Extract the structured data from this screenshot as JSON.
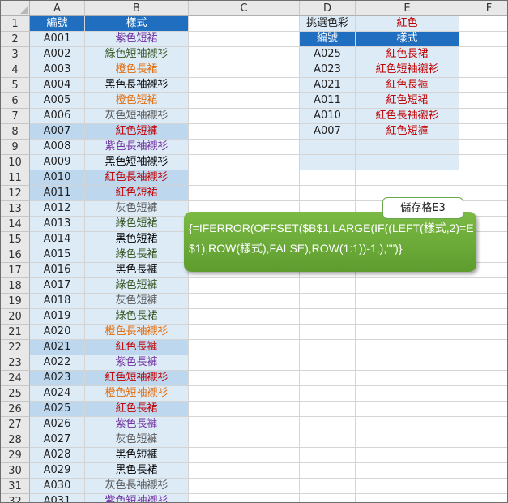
{
  "columns": [
    "A",
    "B",
    "C",
    "D",
    "E",
    "F"
  ],
  "left_table": {
    "header": {
      "code": "編號",
      "style": "樣式"
    },
    "rows": [
      {
        "code": "A001",
        "style": "紫色短裙",
        "color": "#7030a0"
      },
      {
        "code": "A002",
        "style": "綠色短袖襯衫",
        "color": "#375623"
      },
      {
        "code": "A003",
        "style": "橙色長裙",
        "color": "#e46c0a"
      },
      {
        "code": "A004",
        "style": "黑色長袖襯衫",
        "color": "#000000"
      },
      {
        "code": "A005",
        "style": "橙色短裙",
        "color": "#e46c0a"
      },
      {
        "code": "A006",
        "style": "灰色短袖襯衫",
        "color": "#595959"
      },
      {
        "code": "A007",
        "style": "紅色短褲",
        "color": "#c00000"
      },
      {
        "code": "A008",
        "style": "紫色長袖襯衫",
        "color": "#7030a0"
      },
      {
        "code": "A009",
        "style": "黑色短袖襯衫",
        "color": "#000000"
      },
      {
        "code": "A010",
        "style": "紅色長袖襯衫",
        "color": "#c00000"
      },
      {
        "code": "A011",
        "style": "紅色短裙",
        "color": "#c00000"
      },
      {
        "code": "A012",
        "style": "灰色短褲",
        "color": "#595959"
      },
      {
        "code": "A013",
        "style": "綠色短裙",
        "color": "#375623"
      },
      {
        "code": "A014",
        "style": "黑色短裙",
        "color": "#000000"
      },
      {
        "code": "A015",
        "style": "綠色長裙",
        "color": "#375623"
      },
      {
        "code": "A016",
        "style": "黑色長褲",
        "color": "#000000"
      },
      {
        "code": "A017",
        "style": "綠色短褲",
        "color": "#375623"
      },
      {
        "code": "A018",
        "style": "灰色短褲",
        "color": "#595959"
      },
      {
        "code": "A019",
        "style": "綠色長裙",
        "color": "#375623"
      },
      {
        "code": "A020",
        "style": "橙色長袖襯衫",
        "color": "#e46c0a"
      },
      {
        "code": "A021",
        "style": "紅色長褲",
        "color": "#c00000"
      },
      {
        "code": "A022",
        "style": "紫色長褲",
        "color": "#7030a0"
      },
      {
        "code": "A023",
        "style": "紅色短袖襯衫",
        "color": "#c00000"
      },
      {
        "code": "A024",
        "style": "橙色短袖襯衫",
        "color": "#e46c0a"
      },
      {
        "code": "A025",
        "style": "紅色長裙",
        "color": "#c00000"
      },
      {
        "code": "A026",
        "style": "紫色長褲",
        "color": "#7030a0"
      },
      {
        "code": "A027",
        "style": "灰色短褲",
        "color": "#595959"
      },
      {
        "code": "A028",
        "style": "黑色短褲",
        "color": "#000000"
      },
      {
        "code": "A029",
        "style": "黑色長裙",
        "color": "#000000"
      },
      {
        "code": "A030",
        "style": "灰色長袖襯衫",
        "color": "#595959"
      },
      {
        "code": "A031",
        "style": "紫色短袖襯衫",
        "color": "#7030a0"
      }
    ],
    "highlighted_codes": [
      "A007",
      "A010",
      "A011",
      "A021",
      "A023",
      "A025"
    ]
  },
  "filter": {
    "label": "挑選色彩",
    "value": "紅色"
  },
  "right_table": {
    "header": {
      "code": "編號",
      "style": "樣式"
    },
    "rows": [
      {
        "code": "A025",
        "style": "紅色長裙"
      },
      {
        "code": "A023",
        "style": "紅色短袖襯衫"
      },
      {
        "code": "A021",
        "style": "紅色長褲"
      },
      {
        "code": "A011",
        "style": "紅色短裙"
      },
      {
        "code": "A010",
        "style": "紅色長袖襯衫"
      },
      {
        "code": "A007",
        "style": "紅色短褲"
      }
    ],
    "blank_rows": 2
  },
  "callout": {
    "title": "儲存格E3",
    "formula": "{=IFERROR(OFFSET($B$1,LARGE(IF((LEFT(樣式,2)=E$1),ROW(樣式),FALSE),ROW(1:1))-1,),\"\")}"
  },
  "colors": {
    "header_fill": "#1f6ec0",
    "light_fill": "#ddebf7",
    "highlight_fill": "#bdd7ee",
    "red_text": "#c00000",
    "callout_green": "#70ad47"
  }
}
